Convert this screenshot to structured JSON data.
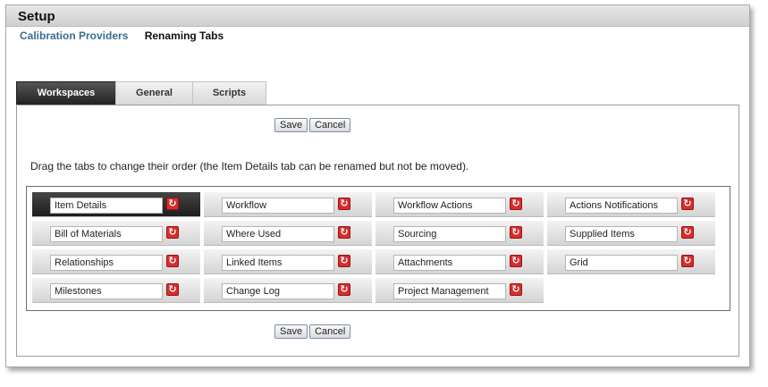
{
  "header": {
    "title": "Setup"
  },
  "subnav": {
    "link": "Calibration Providers",
    "active": "Renaming Tabs"
  },
  "tabs": [
    {
      "label": "Workspaces",
      "active": true
    },
    {
      "label": "General",
      "active": false
    },
    {
      "label": "Scripts",
      "active": false
    }
  ],
  "buttons": {
    "save": "Save",
    "cancel": "Cancel"
  },
  "instructions": "Drag the tabs to change their order (the Item Details tab can be renamed but not be moved).",
  "tab_names": [
    "Item Details",
    "Workflow",
    "Workflow Actions",
    "Actions Notifications",
    "Bill of Materials",
    "Where Used",
    "Sourcing",
    "Supplied Items",
    "Relationships",
    "Linked Items",
    "Attachments",
    "Grid",
    "Milestones",
    "Change Log",
    "Project Management"
  ],
  "reset_icon": "refresh-icon",
  "colors": {
    "active_tab": "#2a2a2a",
    "link": "#3d6e8f",
    "reset": "#d82c2c"
  }
}
